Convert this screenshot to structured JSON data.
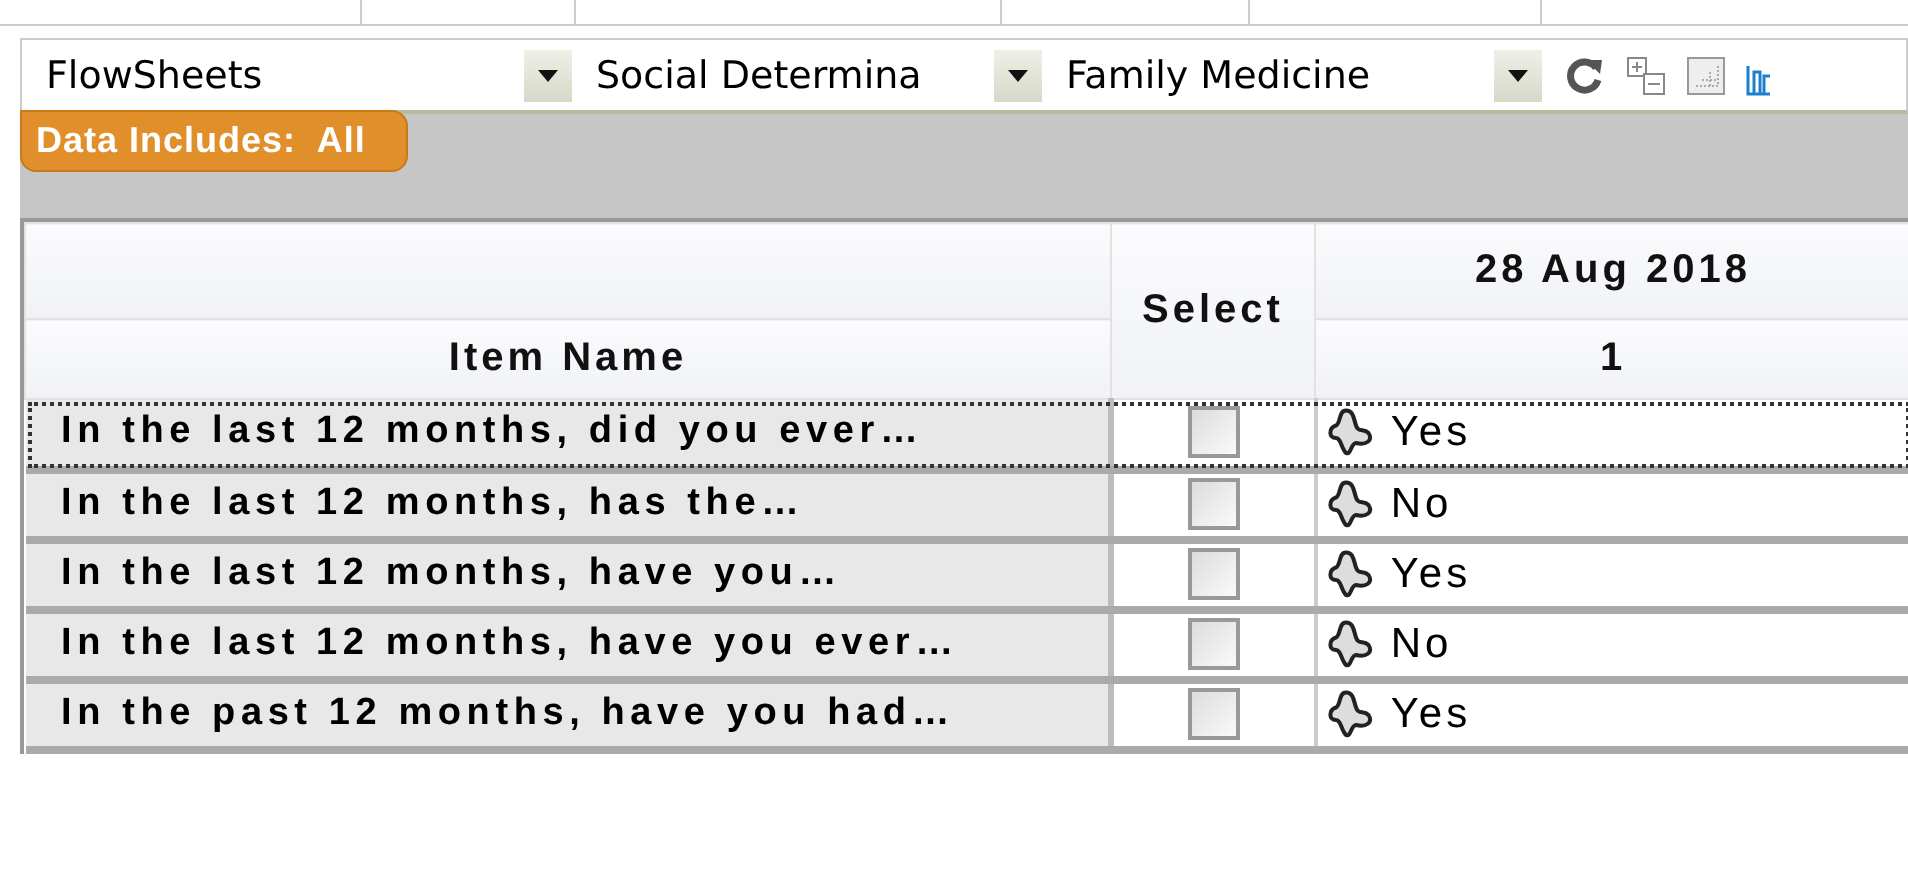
{
  "toolbar": {
    "dropdowns": [
      {
        "value": "FlowSheets"
      },
      {
        "value": "Social Determina"
      },
      {
        "value": "Family Medicine"
      }
    ]
  },
  "filter_badge": "Data Includes:  All",
  "table": {
    "columns": {
      "item_name": "Item Name",
      "select": "Select",
      "date": "28 Aug 2018",
      "date_sub": "1"
    },
    "rows": [
      {
        "item": "In the last 12 months, did you ever…",
        "checked": false,
        "value": "Yes",
        "selected": true
      },
      {
        "item": "In the last 12 months, has the…",
        "checked": false,
        "value": "No",
        "selected": false
      },
      {
        "item": "In the last 12 months, have you…",
        "checked": false,
        "value": "Yes",
        "selected": false
      },
      {
        "item": "In the last 12 months, have you ever…",
        "checked": false,
        "value": "No",
        "selected": false
      },
      {
        "item": "In the past 12 months, have you had…",
        "checked": false,
        "value": "Yes",
        "selected": false
      }
    ]
  }
}
